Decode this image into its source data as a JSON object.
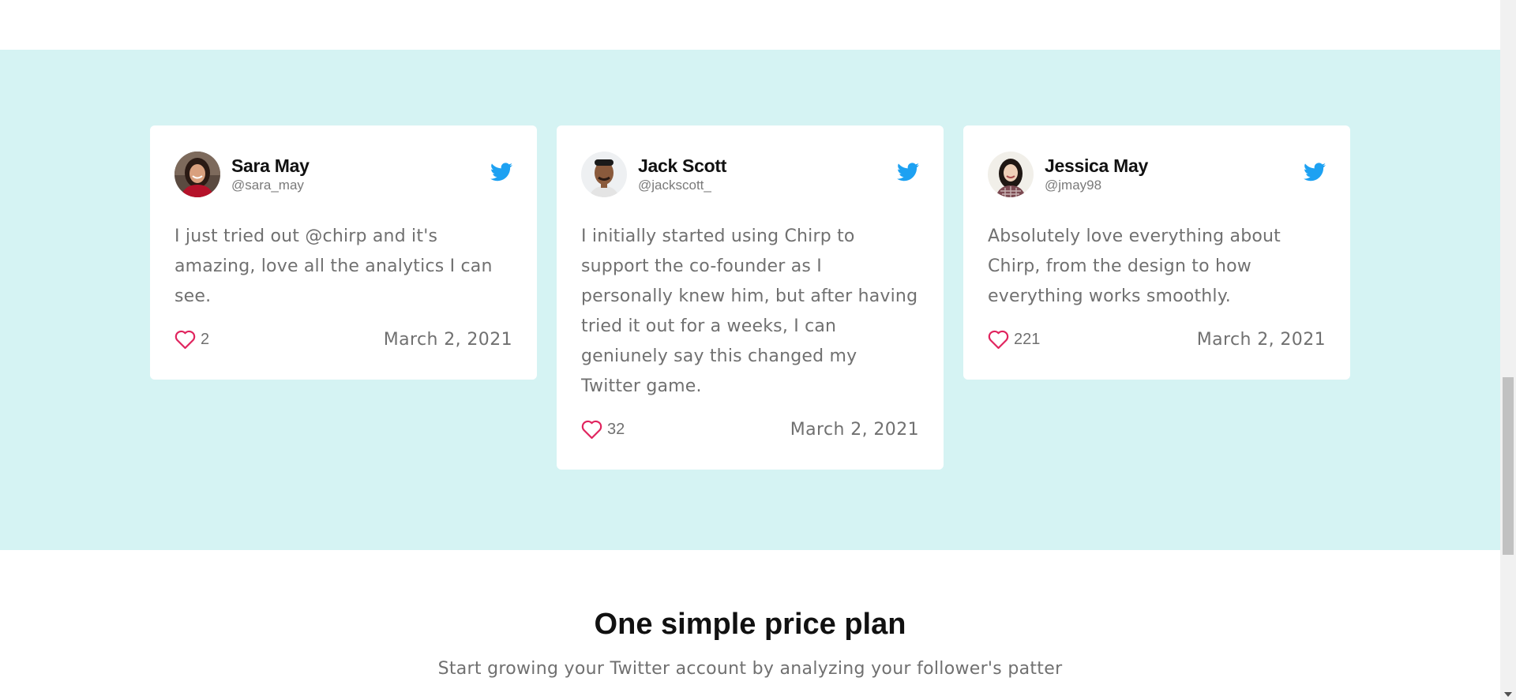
{
  "testimonials": [
    {
      "name": "Sara May",
      "handle": "@sara_may",
      "text": "I just tried out @chirp and it's amazing, love all the analytics I can see.",
      "likes": "2",
      "date": "March 2, 2021",
      "avatar_icon": "avatar-woman-red-top"
    },
    {
      "name": "Jack Scott",
      "handle": "@jackscott_",
      "text": "I initially started using Chirp to support the co-founder as I personally knew him, but after having tried it out for a weeks, I can geniunely say this changed my Twitter game.",
      "likes": "32",
      "date": "March 2, 2021",
      "avatar_icon": "avatar-man"
    },
    {
      "name": "Jessica May",
      "handle": "@jmay98",
      "text": "Absolutely love everything about Chirp, from the design to how everything works smoothly.",
      "likes": "221",
      "date": "March 2, 2021",
      "avatar_icon": "avatar-woman-plaid"
    }
  ],
  "pricing": {
    "title": "One simple price plan",
    "subtitle": "Start growing your Twitter account by analyzing your follower's patter"
  },
  "colors": {
    "section_bg": "#d5f3f3",
    "twitter_blue": "#1da1f2",
    "heart_red": "#e0245e",
    "muted_text": "#707070"
  },
  "icons": {
    "twitter": "twitter-bird-icon",
    "like": "heart-icon"
  }
}
